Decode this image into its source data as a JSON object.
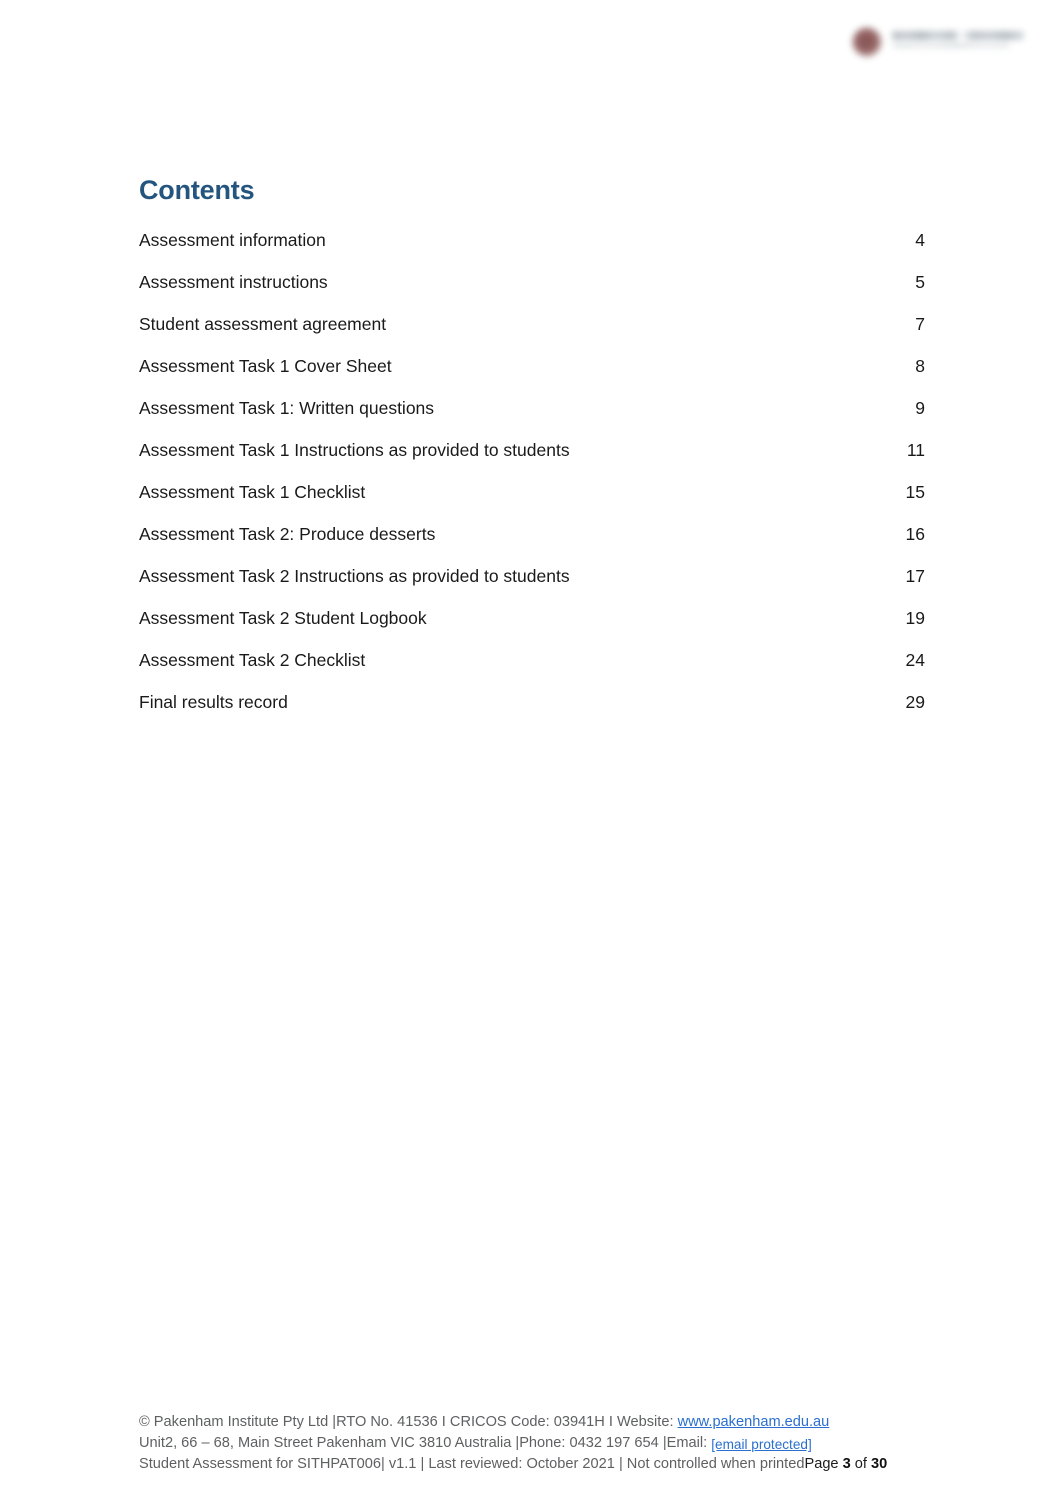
{
  "document": {
    "heading": "Contents",
    "logo": {
      "mark_icon": "pakenham-logo-mark",
      "mark_color": "#7c4747",
      "text_color": "#a9b3ba"
    }
  },
  "toc": {
    "entries": [
      {
        "title": "Assessment information",
        "page": "4"
      },
      {
        "title": "Assessment instructions",
        "page": "5"
      },
      {
        "title": "Student assessment agreement",
        "page": "7"
      },
      {
        "title": "Assessment Task 1 Cover Sheet",
        "page": "8"
      },
      {
        "title": "Assessment Task 1: Written questions",
        "page": "9"
      },
      {
        "title": "Assessment Task 1 Instructions as provided to students",
        "page": "11"
      },
      {
        "title": "Assessment Task 1 Checklist",
        "page": "15"
      },
      {
        "title": "Assessment Task 2: Produce desserts",
        "page": "16"
      },
      {
        "title": "Assessment Task 2 Instructions as provided to students",
        "page": "17"
      },
      {
        "title": "Assessment Task 2 Student Logbook",
        "page": "19"
      },
      {
        "title": "Assessment Task 2 Checklist",
        "page": "24"
      },
      {
        "title": "Final results record",
        "page": "29"
      }
    ]
  },
  "footer": {
    "line1_prefix": "© Pakenham Institute Pty Ltd |RTO No. 41536 I CRICOS Code: 03941H I Website: ",
    "website": "www.pakenham.edu.au",
    "line2_prefix": "Unit2, 66 – 68, Main Street Pakenham VIC 3810 Australia |Phone: 0432 197 654 |Email: ",
    "email": "[email protected]",
    "line3_prefix": "Student Assessment for SITHPAT006| v1.1 | Last reviewed: October 2021 | Not controlled when printed",
    "page_label": "Page ",
    "page_current": "3",
    "page_of": " of ",
    "page_total": "30",
    "link_color": "#2a6fcf",
    "text_color": "#5f6062"
  }
}
